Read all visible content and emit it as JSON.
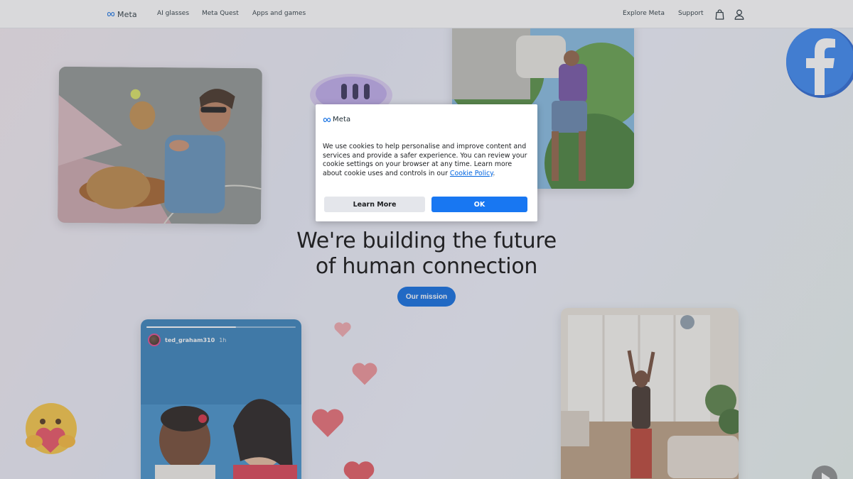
{
  "header": {
    "logo_text": "Meta",
    "nav_left": [
      "AI glasses",
      "Meta Quest",
      "Apps and games"
    ],
    "nav_right": [
      "Explore Meta",
      "Support"
    ],
    "icons": [
      "shopping-bag-icon",
      "user-account-icon"
    ]
  },
  "hero": {
    "title_line1": "We're building the future",
    "title_line2": "of human connection",
    "mission_button": "Our mission"
  },
  "story": {
    "username": "ted_graham310",
    "time": "1h",
    "progress": 0.6
  },
  "cookie_dialog": {
    "logo_text": "Meta",
    "body": "We use cookies to help personalise and improve content and services and provide a safer experience. You can review your cookie settings on your browser at any time. Learn more about cookie uses and controls in our ",
    "policy_link": "Cookie Policy",
    "body_end": ".",
    "learn_more_label": "Learn More",
    "ok_label": "OK"
  },
  "colors": {
    "brand_blue": "#0064e0",
    "ok_button": "#1877f2",
    "learn_more_button": "#e4e6eb",
    "heart": "#e8646c"
  }
}
